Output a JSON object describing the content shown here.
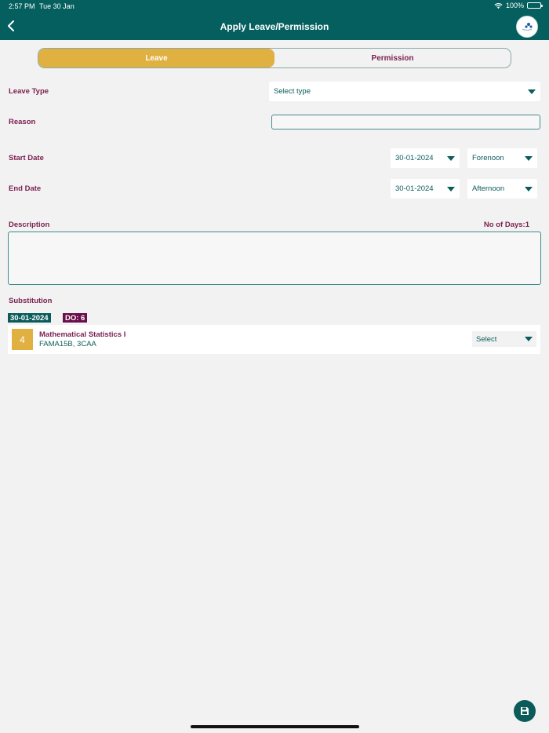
{
  "status": {
    "time": "2:57 PM",
    "date": "Tue 30 Jan",
    "battery": "100%"
  },
  "header": {
    "title": "Apply Leave/Permission"
  },
  "tabs": [
    {
      "label": "Leave",
      "active": true
    },
    {
      "label": "Permission",
      "active": false
    }
  ],
  "form": {
    "leave_type_label": "Leave Type",
    "leave_type_value": "Select type",
    "reason_label": "Reason",
    "reason_value": "",
    "start_date_label": "Start Date",
    "start_date_value": "30-01-2024",
    "start_session_value": "Forenoon",
    "end_date_label": "End Date",
    "end_date_value": "30-01-2024",
    "end_session_value": "Afternoon",
    "description_label": "Description",
    "description_value": "",
    "no_of_days": "No of Days:1"
  },
  "substitution": {
    "label": "Substitution",
    "date_badge": "30-01-2024",
    "do_badge": "DO: 6",
    "entries": [
      {
        "period": "4",
        "subject": "Mathematical Statistics I",
        "classes": "FAMA15B, 3CAA",
        "select_value": "Select"
      }
    ]
  },
  "colors": {
    "primary": "#055f5f",
    "accent": "#e0b040",
    "label": "#7a1f4f"
  }
}
